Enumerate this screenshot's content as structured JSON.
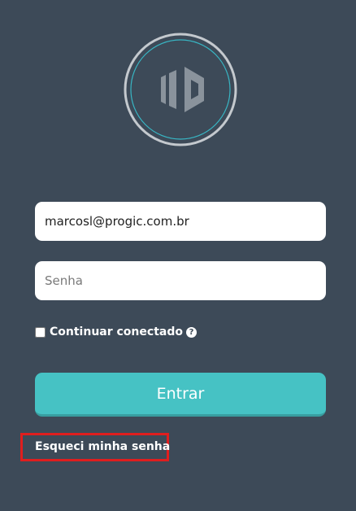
{
  "colors": {
    "background": "#3d4a58",
    "accent": "#46c2c4",
    "highlight": "#e01e1e",
    "logo_mark": "#8a939c",
    "logo_ring_outer": "#c4c9ce",
    "logo_ring_inner": "#38b6c4"
  },
  "logo": {
    "icon": "brand-logo-icon"
  },
  "login": {
    "email_value": "marcosl@progic.com.br",
    "password_placeholder": "Senha",
    "remember_label": "Continuar conectado",
    "remember_checked": false,
    "help_icon": "question-circle-icon",
    "help_glyph": "?",
    "submit_label": "Entrar",
    "forgot_label": "Esqueci minha senha"
  }
}
